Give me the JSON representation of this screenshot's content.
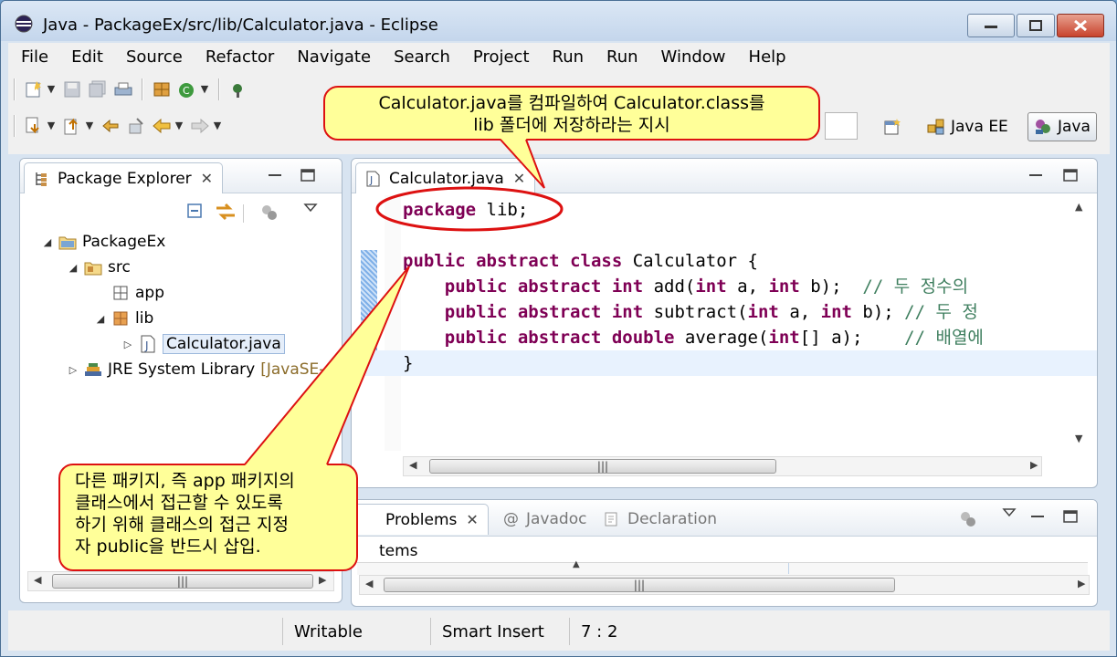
{
  "window": {
    "title": "Java - PackageEx/src/lib/Calculator.java - Eclipse"
  },
  "menu": [
    "File",
    "Edit",
    "Source",
    "Refactor",
    "Navigate",
    "Search",
    "Project",
    "Run",
    "Run",
    "Window",
    "Help"
  ],
  "perspectives": {
    "java_ee": "Java EE",
    "java": "Java"
  },
  "package_explorer": {
    "tab_label": "Package Explorer",
    "tree": [
      {
        "label": "PackageEx",
        "icon": "project-folder-icon"
      },
      {
        "label": "src",
        "icon": "source-folder-icon"
      },
      {
        "label": "app",
        "icon": "package-icon"
      },
      {
        "label": "lib",
        "icon": "package-icon"
      },
      {
        "label": "Calculator.java",
        "icon": "java-file-icon"
      },
      {
        "label": "JRE System Library",
        "suffix": "[JavaSE-",
        "icon": "library-icon"
      }
    ]
  },
  "editor": {
    "tab_label": "Calculator.java",
    "code": [
      {
        "tokens": [
          {
            "t": "package",
            "k": "kw"
          },
          {
            "t": " lib;",
            "k": ""
          }
        ]
      },
      {
        "tokens": []
      },
      {
        "tokens": [
          {
            "t": "public",
            "k": "kw"
          },
          {
            "t": " ",
            "k": ""
          },
          {
            "t": "abstract",
            "k": "kw"
          },
          {
            "t": " ",
            "k": ""
          },
          {
            "t": "class",
            "k": "kw"
          },
          {
            "t": " Calculator {",
            "k": ""
          }
        ]
      },
      {
        "tokens": [
          {
            "t": "    ",
            "k": ""
          },
          {
            "t": "public",
            "k": "kw"
          },
          {
            "t": " ",
            "k": ""
          },
          {
            "t": "abstract",
            "k": "kw"
          },
          {
            "t": " ",
            "k": ""
          },
          {
            "t": "int",
            "k": "kw"
          },
          {
            "t": " add(",
            "k": ""
          },
          {
            "t": "int",
            "k": "kw"
          },
          {
            "t": " a, ",
            "k": ""
          },
          {
            "t": "int",
            "k": "kw"
          },
          {
            "t": " b);  ",
            "k": ""
          },
          {
            "t": "// 두 정수의",
            "k": "cm"
          }
        ]
      },
      {
        "tokens": [
          {
            "t": "    ",
            "k": ""
          },
          {
            "t": "public",
            "k": "kw"
          },
          {
            "t": " ",
            "k": ""
          },
          {
            "t": "abstract",
            "k": "kw"
          },
          {
            "t": " ",
            "k": ""
          },
          {
            "t": "int",
            "k": "kw"
          },
          {
            "t": " subtract(",
            "k": ""
          },
          {
            "t": "int",
            "k": "kw"
          },
          {
            "t": " a, ",
            "k": ""
          },
          {
            "t": "int",
            "k": "kw"
          },
          {
            "t": " b); ",
            "k": ""
          },
          {
            "t": "// 두 정",
            "k": "cm"
          }
        ]
      },
      {
        "tokens": [
          {
            "t": "    ",
            "k": ""
          },
          {
            "t": "public",
            "k": "kw"
          },
          {
            "t": " ",
            "k": ""
          },
          {
            "t": "abstract",
            "k": "kw"
          },
          {
            "t": " ",
            "k": ""
          },
          {
            "t": "double",
            "k": "kw"
          },
          {
            "t": " average(",
            "k": ""
          },
          {
            "t": "int",
            "k": "kw"
          },
          {
            "t": "[] a);    ",
            "k": ""
          },
          {
            "t": "// 배열에",
            "k": "cm"
          }
        ]
      },
      {
        "tokens": [
          {
            "t": "}",
            "k": ""
          }
        ]
      }
    ]
  },
  "bottom_panel": {
    "tabs": [
      "Problems",
      "Javadoc",
      "Declaration"
    ],
    "content_label": "tems"
  },
  "status": {
    "writable": "Writable",
    "insert_mode": "Smart Insert",
    "position": "7 : 2"
  },
  "annotations": {
    "top": [
      "Calculator.java를 컴파일하여 Calculator.class를",
      "lib 폴더에 저장하라는 지시"
    ],
    "bottom": [
      "다른 패키지, 즉 app 패키지의",
      "클래스에서 접근할 수 있도록",
      "하기 위해 클래스의 접근 지정",
      "자 public을 반드시 삽입."
    ]
  },
  "colors": {
    "keyword": "#7f0055",
    "comment": "#3f7f5f",
    "callout_fill": "#ffff99",
    "callout_border": "#dd1111"
  }
}
